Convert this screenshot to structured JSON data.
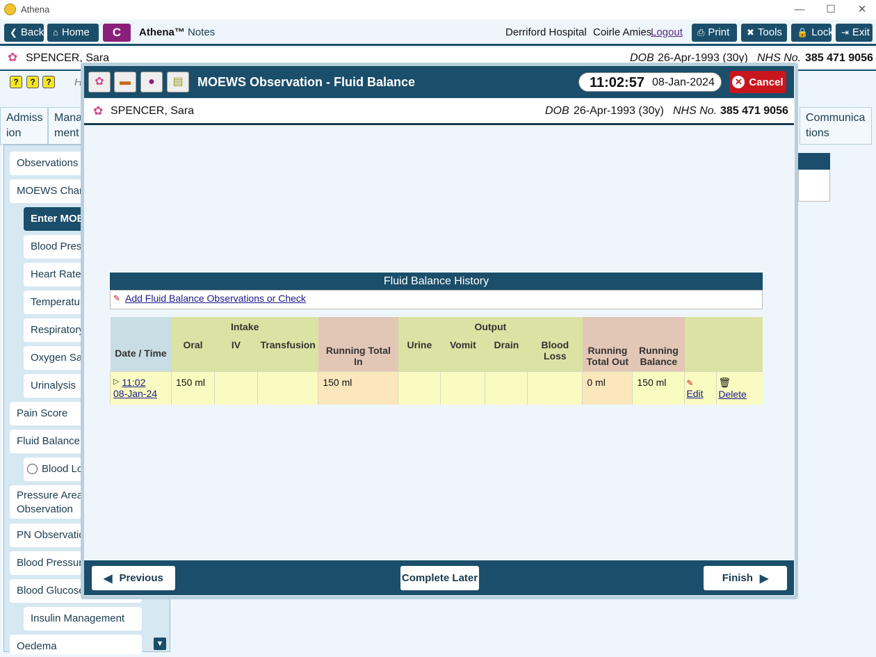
{
  "app": {
    "title": "Athena"
  },
  "toolbar": {
    "back": "Back",
    "home": "Home",
    "c": "C",
    "brand": "Athena™",
    "brand_sub": "Notes",
    "hospital": "Derriford Hospital",
    "user": "Coirle Amies",
    "logout": "Logout",
    "print": "Print",
    "tools": "Tools",
    "lock": "Lock",
    "exit": "Exit"
  },
  "patient": {
    "name": "SPENCER, Sara",
    "dob_label": "DOB",
    "dob": "26-Apr-1993 (30y)",
    "nhs_label": "NHS No.",
    "nhs": "385 471 9056"
  },
  "tabs": {
    "admission": "Admiss ion",
    "management": "Mana ment",
    "communications": "Communica tions"
  },
  "obscured": {
    "h": "H"
  },
  "nav": [
    "Observations",
    "MOEWS Chart",
    "Enter MOEWS",
    "Blood Press",
    "Heart Rate",
    "Temperatur",
    "Respiratory",
    "Oxygen Sat",
    "Urinalysis",
    "Pain Score",
    "Fluid Balance",
    "Blood Lo",
    "Pressure Areas Observation",
    "PN Observatio",
    "Blood Pressur",
    "Blood Glucose",
    "Insulin Management",
    "Oedema"
  ],
  "modal": {
    "title": "MOEWS Observation - Fluid Balance",
    "time": "11:02:57",
    "date": "08-Jan-2024",
    "cancel": "Cancel",
    "history_title": "Fluid Balance History",
    "add_link": "Add Fluid Balance Observations or Check",
    "headers": {
      "date_time": "Date / Time",
      "intake": "Intake",
      "oral": "Oral",
      "iv": "IV",
      "transfusion": "Transfusion",
      "running_total_in": "Running Total In",
      "output": "Output",
      "urine": "Urine",
      "vomit": "Vomit",
      "drain": "Drain",
      "blood_loss": "Blood Loss",
      "running_total_out": "Running Total Out",
      "running_balance": "Running Balance"
    },
    "rows": [
      {
        "time": "11:02",
        "date": "08-Jan-24",
        "oral": "150 ml",
        "iv": "",
        "transfusion": "",
        "rt_in": "150 ml",
        "urine": "",
        "vomit": "",
        "drain": "",
        "blood_loss": "",
        "rt_out": "0 ml",
        "balance": "150 ml",
        "edit": "Edit",
        "delete": "Delete"
      }
    ],
    "previous": "Previous",
    "complete_later": "Complete Later",
    "finish": "Finish"
  },
  "colors": {
    "primary": "#1a4e6a",
    "accent": "#8a1e7a",
    "danger": "#c8161e"
  }
}
